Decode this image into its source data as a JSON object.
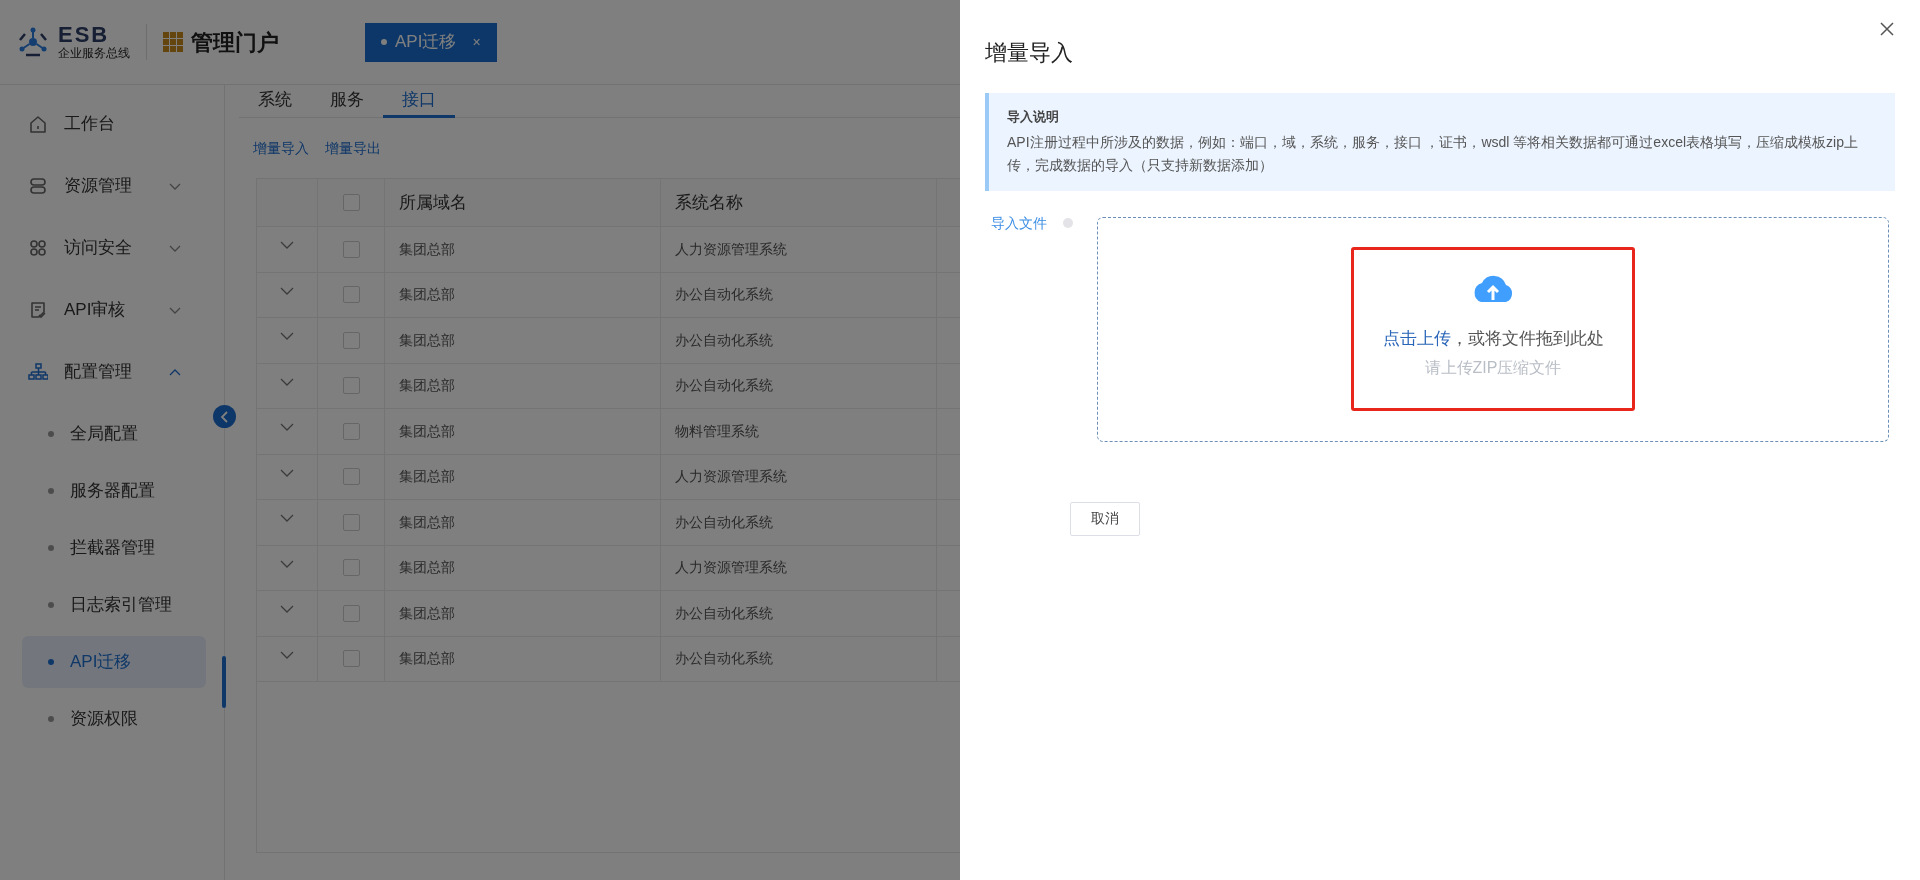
{
  "header": {
    "logo_text": "ESB",
    "logo_subtitle": "企业服务总线",
    "portal_title": "管理门户",
    "open_tabs": [
      {
        "label": "API迁移",
        "selected": true,
        "close": "×"
      }
    ]
  },
  "sidebar": {
    "items": [
      {
        "label": "工作台"
      },
      {
        "label": "资源管理",
        "expanded": false
      },
      {
        "label": "访问安全",
        "expanded": false
      },
      {
        "label": "API审核",
        "expanded": false
      },
      {
        "label": "配置管理",
        "expanded": true,
        "children": [
          {
            "label": "全局配置",
            "selected": false
          },
          {
            "label": "服务器配置",
            "selected": false
          },
          {
            "label": "拦截器管理",
            "selected": false
          },
          {
            "label": "日志索引管理",
            "selected": false
          },
          {
            "label": "API迁移",
            "selected": true
          },
          {
            "label": "资源权限",
            "selected": false
          }
        ]
      }
    ]
  },
  "tabs": [
    {
      "label": "系统",
      "selected": false
    },
    {
      "label": "服务",
      "selected": false
    },
    {
      "label": "接口",
      "selected": true
    }
  ],
  "actions": [
    "增量导入",
    "增量导出"
  ],
  "table": {
    "columns": [
      "所属域名",
      "系统名称"
    ],
    "all_checked": false,
    "rows": [
      {
        "domain": "集团总部",
        "system": "人力资源管理系统",
        "checked": false,
        "expanded": false
      },
      {
        "domain": "集团总部",
        "system": "办公自动化系统",
        "checked": false,
        "expanded": false
      },
      {
        "domain": "集团总部",
        "system": "办公自动化系统",
        "checked": false,
        "expanded": false
      },
      {
        "domain": "集团总部",
        "system": "办公自动化系统",
        "checked": false,
        "expanded": false
      },
      {
        "domain": "集团总部",
        "system": "物料管理系统",
        "checked": false,
        "expanded": false
      },
      {
        "domain": "集团总部",
        "system": "人力资源管理系统",
        "checked": false,
        "expanded": false
      },
      {
        "domain": "集团总部",
        "system": "办公自动化系统",
        "checked": false,
        "expanded": false
      },
      {
        "domain": "集团总部",
        "system": "人力资源管理系统",
        "checked": false,
        "expanded": false
      },
      {
        "domain": "集团总部",
        "system": "办公自动化系统",
        "checked": false,
        "expanded": false
      },
      {
        "domain": "集团总部",
        "system": "办公自动化系统",
        "checked": false,
        "expanded": false
      }
    ]
  },
  "drawer": {
    "title": "增量导入",
    "notice": {
      "title": "导入说明",
      "text": "API注册过程中所涉及的数据，例如：端口，域，系统，服务，接口 ，证书，wsdl 等将相关数据都可通过excel表格填写，压缩成模板zip上传，完成数据的导入（只支持新数据添加）"
    },
    "field_label": "导入文件",
    "upload": {
      "link": "点击上传",
      "prompt": "，或将文件拖到此处",
      "hint": "请上传ZIP压缩文件",
      "highlighted": true
    },
    "buttons": [
      "取消"
    ]
  }
}
